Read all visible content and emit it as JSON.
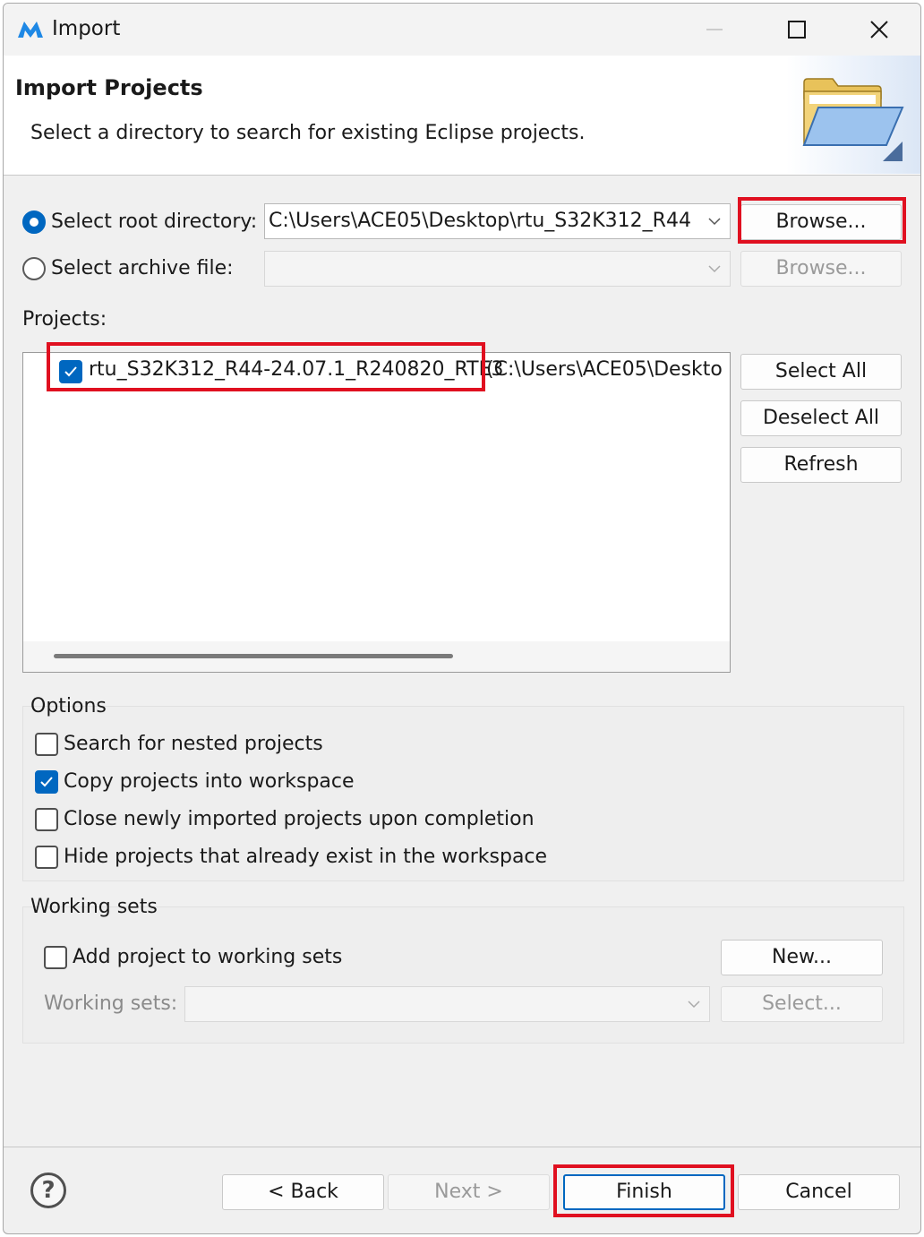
{
  "window": {
    "title": "Import"
  },
  "header": {
    "title": "Import Projects",
    "description": "Select a directory to search for existing Eclipse projects."
  },
  "source": {
    "root_label": "Select root directory:",
    "root_value": "C:\\Users\\ACE05\\Desktop\\rtu_S32K312_R44",
    "root_selected": true,
    "archive_label": "Select archive file:",
    "archive_value": "",
    "archive_selected": false,
    "browse_label": "Browse...",
    "browse_archive_label": "Browse..."
  },
  "projects": {
    "label": "Projects:",
    "items": [
      {
        "name": "rtu_S32K312_R44-24.07.1_R240820_RTE3",
        "path": "(C:\\Users\\ACE05\\Deskto",
        "checked": true
      }
    ],
    "buttons": {
      "select_all": "Select All",
      "deselect_all": "Deselect All",
      "refresh": "Refresh"
    }
  },
  "options": {
    "title": "Options",
    "items": [
      {
        "label": "Search for nested projects",
        "checked": false
      },
      {
        "label": "Copy projects into workspace",
        "checked": true
      },
      {
        "label": "Close newly imported projects upon completion",
        "checked": false
      },
      {
        "label": "Hide projects that already exist in the workspace",
        "checked": false
      }
    ]
  },
  "working_sets": {
    "title": "Working sets",
    "add_label": "Add project to working sets",
    "add_checked": false,
    "new_label": "New...",
    "sets_label": "Working sets:",
    "sets_value": "",
    "select_label": "Select..."
  },
  "footer": {
    "help_symbol": "?",
    "back": "< Back",
    "next": "Next >",
    "finish": "Finish",
    "cancel": "Cancel"
  },
  "colors": {
    "accent": "#0067c0",
    "highlight": "#e01020"
  }
}
